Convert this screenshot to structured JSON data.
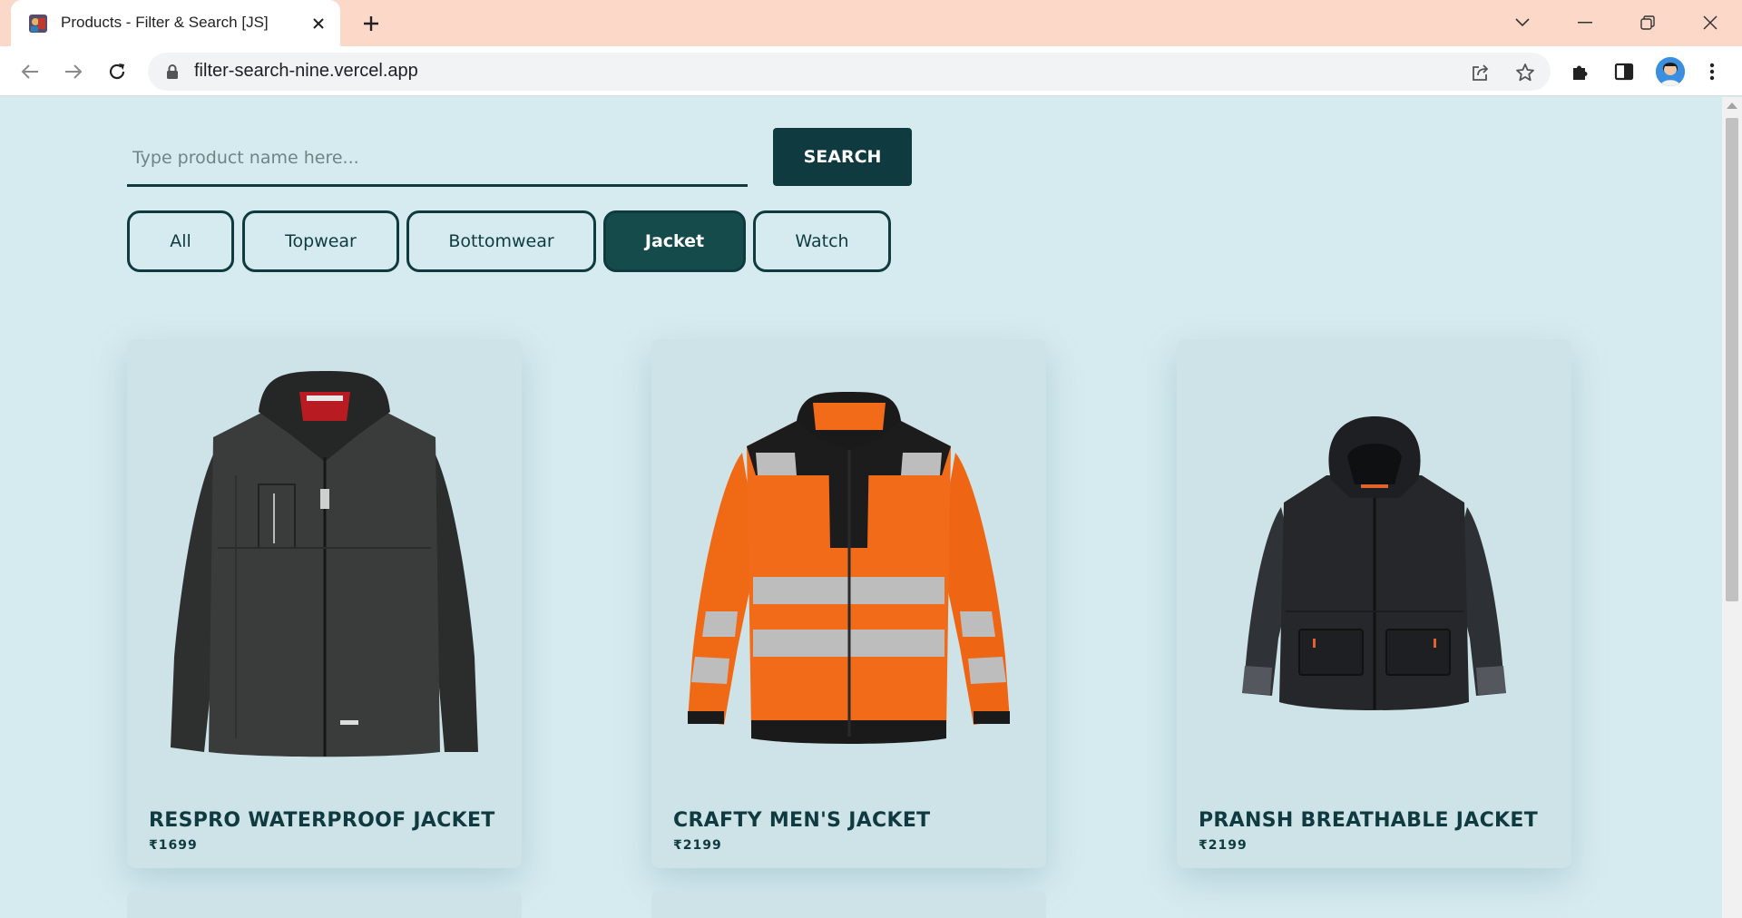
{
  "browser": {
    "tab_title": "Products - Filter & Search [JS]",
    "url": "filter-search-nine.vercel.app"
  },
  "search": {
    "placeholder": "Type product name here...",
    "value": "",
    "button_label": "SEARCH"
  },
  "filters": [
    {
      "label": "All",
      "active": false
    },
    {
      "label": "Topwear",
      "active": false
    },
    {
      "label": "Bottomwear",
      "active": false
    },
    {
      "label": "Jacket",
      "active": true
    },
    {
      "label": "Watch",
      "active": false
    }
  ],
  "products": [
    {
      "name": "RESPRO WATERPROOF JACKET",
      "price": "₹1699",
      "image": "black-softshell-jacket"
    },
    {
      "name": "CRAFTY MEN'S JACKET",
      "price": "₹2199",
      "image": "orange-hi-vis-jacket"
    },
    {
      "name": "PRANSH BREATHABLE JACKET",
      "price": "₹2199",
      "image": "black-hooded-parka"
    }
  ],
  "colors": {
    "page_bg": "#d6ebef",
    "card_bg": "#cde3e8",
    "accent_dark": "#0f3b40",
    "active_filter": "#164b4c",
    "tabstrip": "#fcd8c8"
  }
}
